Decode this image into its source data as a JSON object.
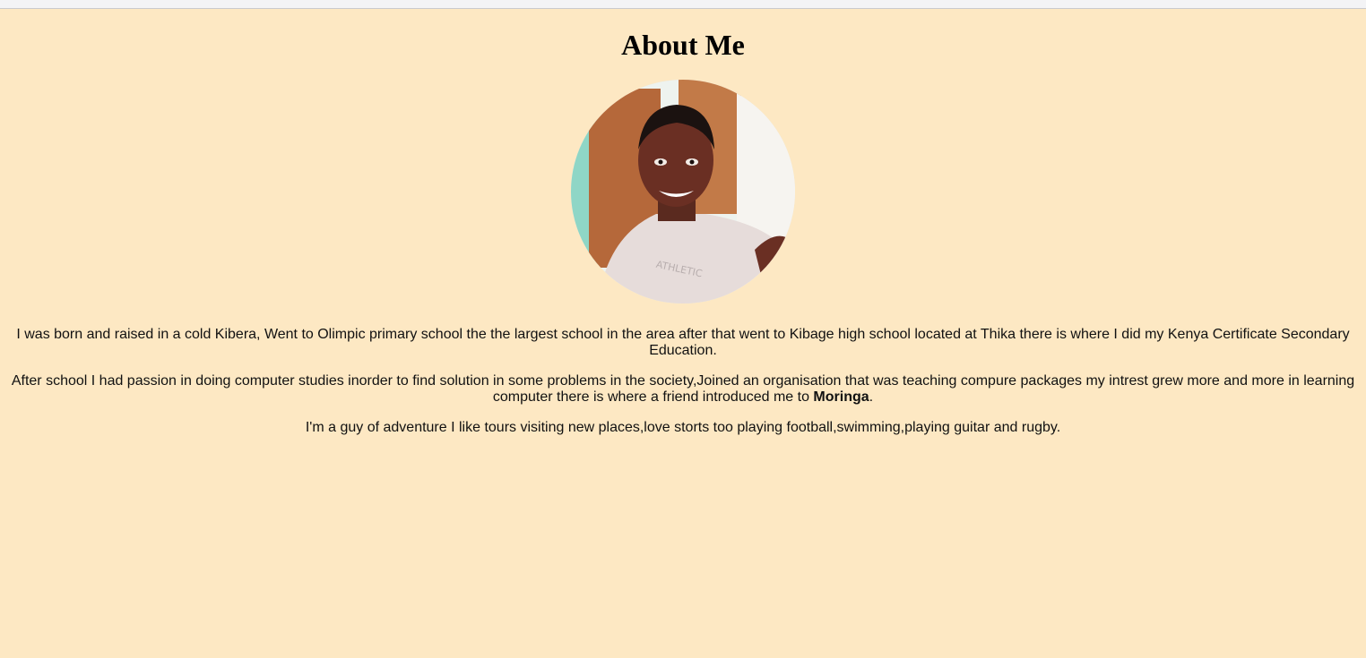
{
  "page": {
    "title": "About Me",
    "background_color": "#fde8c3"
  },
  "profile_photo": {
    "icon": "profile-photo"
  },
  "bio": {
    "paragraph_1": "I was born and raised in a cold Kibera, Went to Olimpic primary school the the largest school in the area after that went to Kibage high school located at Thika there is where I did my Kenya Certificate Secondary Education.",
    "paragraph_2_text": "After school I had passion in doing computer studies inorder to find solution in some problems in the society,Joined an organisation that was teaching compure packages my intrest grew more and more in learning computer there is where a friend introduced me to ",
    "paragraph_2_bold": "Moringa",
    "paragraph_2_end": ".",
    "paragraph_3": "I'm a guy of adventure I like tours visiting new places,love storts too playing football,swimming,playing guitar and rugby."
  }
}
